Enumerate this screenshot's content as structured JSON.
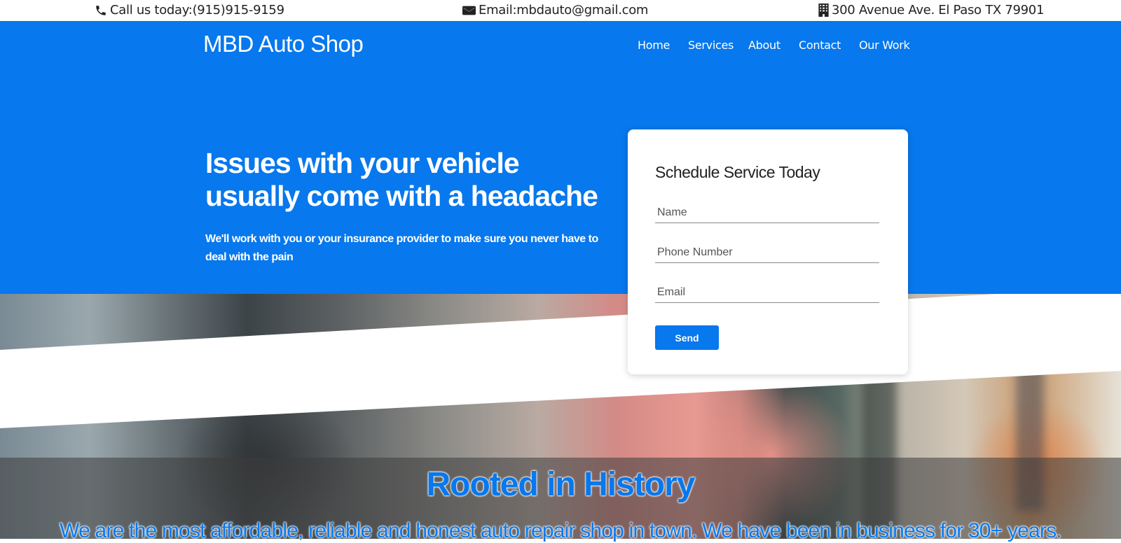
{
  "topbar": {
    "phone": "Call us today:(915)915-9159",
    "email": "Email:mbdauto@gmail.com",
    "address": "300 Avenue Ave. El Paso TX 79901",
    "phone_icon": "phone-icon",
    "email_icon": "envelope-icon",
    "address_icon": "building-icon"
  },
  "header": {
    "brand": "MBD Auto Shop",
    "nav": [
      "Home",
      "Services",
      "About",
      "Contact",
      "Our Work"
    ]
  },
  "hero": {
    "headline": "Issues with your vehicle usually come with a headache",
    "subtext": "We'll work with you or your insurance provider to make sure you never have to deal with the pain"
  },
  "form": {
    "title": "Schedule Service Today",
    "name_placeholder": "Name",
    "phone_placeholder": "Phone Number",
    "email_placeholder": "Email",
    "send_label": "Send"
  },
  "history": {
    "title": "Rooted in History",
    "text": "We are the most affordable, reliable and honest auto repair shop in town. We have been in business for 30+ years."
  },
  "colors": {
    "primary": "#0778ed",
    "white": "#ffffff",
    "text_dark": "#222222"
  }
}
